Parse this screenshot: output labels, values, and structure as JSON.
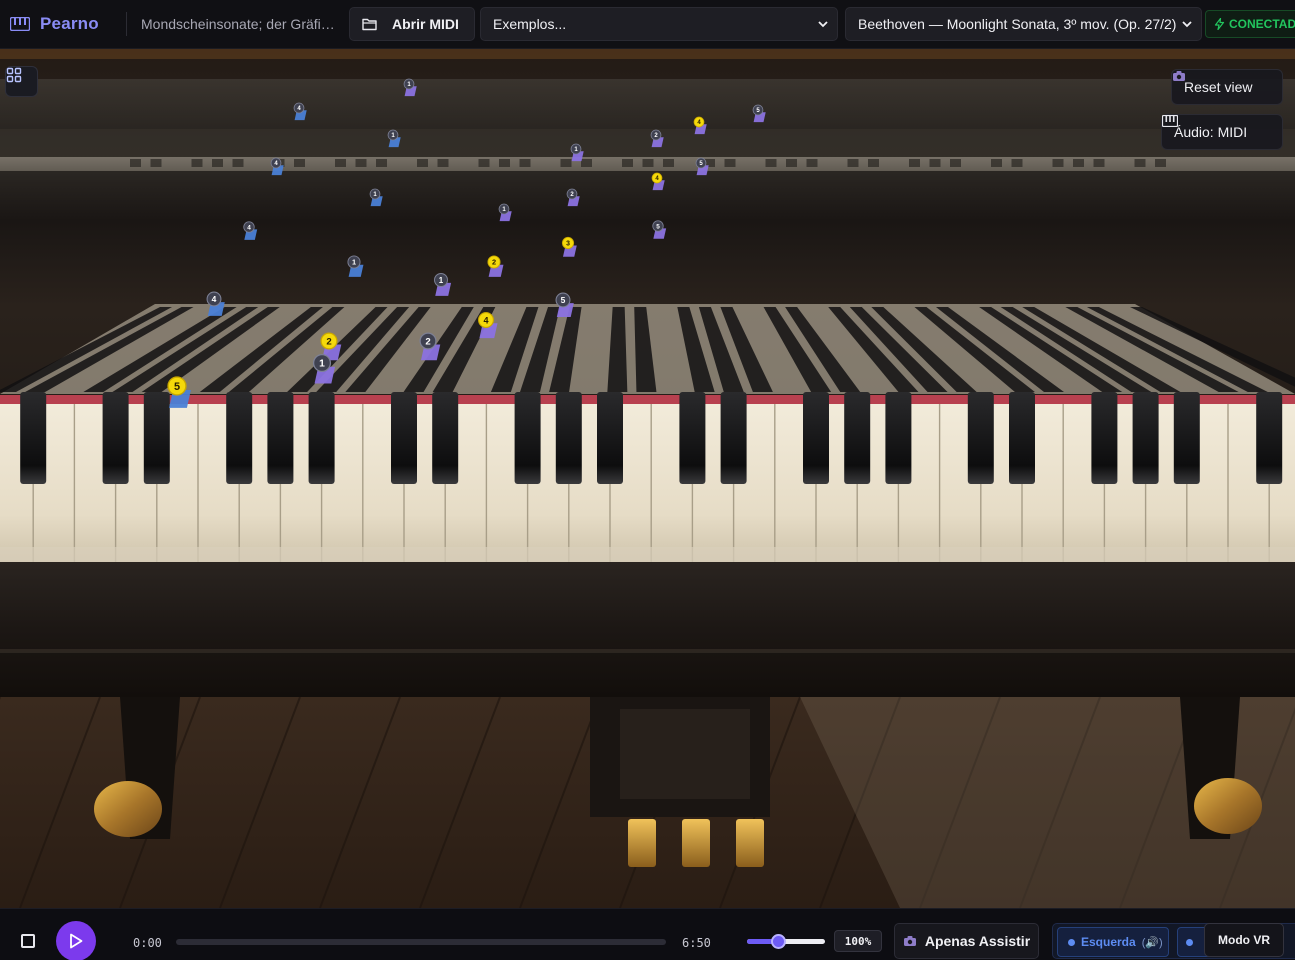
{
  "header": {
    "brand": "Pearno",
    "file_name": "Mondscheinsonate; der Gräfin ...",
    "open_midi_label": "Abrir MIDI",
    "examples_value": "Exemplos...",
    "piece_value": "Beethoven — Moonlight Sonata, 3º mov. (Op. 27/2)",
    "status": "CONECTADO"
  },
  "scene": {
    "reset_view_label": "Reset view",
    "audio_label": "Áudio: MIDI",
    "falling_notes": [
      {
        "f": "5",
        "c": "yellow",
        "hand": "left"
      },
      {
        "f": "4",
        "c": "gray",
        "hand": "left"
      },
      {
        "f": "4",
        "c": "gray",
        "hand": "left"
      },
      {
        "f": "4",
        "c": "gray",
        "hand": "left"
      },
      {
        "f": "4",
        "c": "gray",
        "hand": "left"
      },
      {
        "f": "2",
        "c": "yellow",
        "hand": "right"
      },
      {
        "f": "1",
        "c": "gray",
        "hand": "right"
      },
      {
        "f": "1",
        "c": "gray",
        "hand": "left"
      },
      {
        "f": "1",
        "c": "gray",
        "hand": "left"
      },
      {
        "f": "1",
        "c": "gray",
        "hand": "left"
      },
      {
        "f": "2",
        "c": "gray",
        "hand": "right"
      },
      {
        "f": "1",
        "c": "gray",
        "hand": "right"
      },
      {
        "f": "4",
        "c": "yellow",
        "hand": "right"
      },
      {
        "f": "2",
        "c": "yellow",
        "hand": "right"
      },
      {
        "f": "1",
        "c": "gray",
        "hand": "right"
      },
      {
        "f": "5",
        "c": "gray",
        "hand": "right"
      },
      {
        "f": "3",
        "c": "yellow",
        "hand": "right"
      },
      {
        "f": "2",
        "c": "gray",
        "hand": "right"
      },
      {
        "f": "1",
        "c": "gray",
        "hand": "right"
      },
      {
        "f": "5",
        "c": "gray",
        "hand": "right"
      },
      {
        "f": "4",
        "c": "yellow",
        "hand": "right"
      },
      {
        "f": "2",
        "c": "gray",
        "hand": "right"
      },
      {
        "f": "5",
        "c": "gray",
        "hand": "right"
      },
      {
        "f": "4",
        "c": "yellow",
        "hand": "right"
      },
      {
        "f": "1",
        "c": "gray",
        "hand": "right"
      },
      {
        "f": "5",
        "c": "gray",
        "hand": "right"
      }
    ]
  },
  "player": {
    "current_time": "0:00",
    "total_time": "6:50",
    "progress": 0,
    "speed_label": "100%",
    "speed_fraction": 0.4,
    "watch_label": "Apenas Assistir",
    "left_hand_label": "Esquerda",
    "left_hand_audio": "(🔊)",
    "vr_label": "Modo VR"
  },
  "colors": {
    "brand": "#8a8cf5",
    "accent": "#7c3aed",
    "status": "#22c55e",
    "left_hand": "#4a7fd6",
    "right_hand": "#8b72e0",
    "finger_yellow": "#f5d90a",
    "finger_gray": "#3f4150",
    "felt": "#b8404f"
  },
  "icons": [
    "piano-icon",
    "folder-icon",
    "chevron-down-icon",
    "plug-icon",
    "grid-icon",
    "camera-icon",
    "stop-icon",
    "play-icon",
    "popcorn-icon"
  ]
}
